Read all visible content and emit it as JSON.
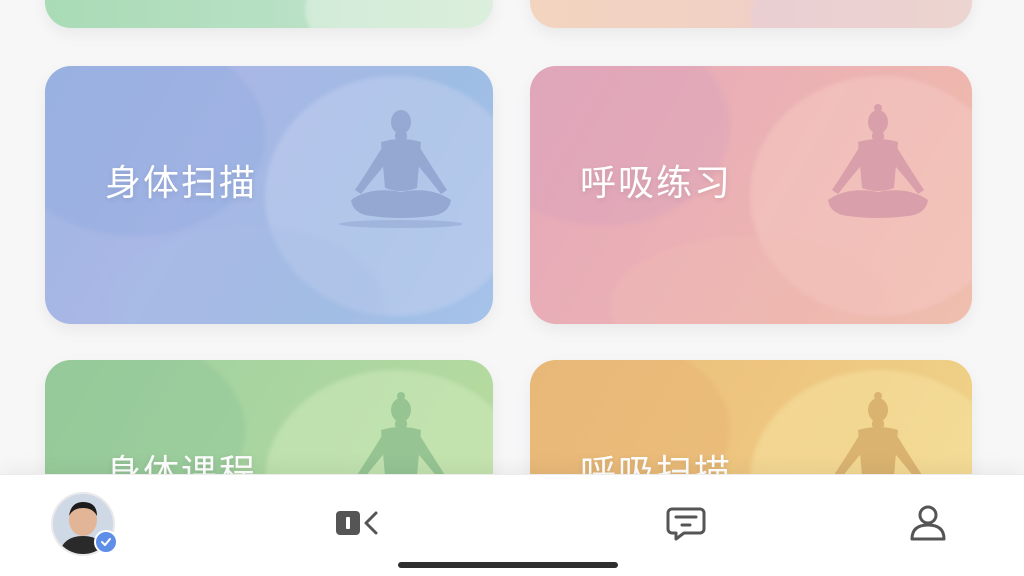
{
  "cards": {
    "body_scan": {
      "title": "身体扫描",
      "icon": "meditation-figure-icon"
    },
    "breathing_practice": {
      "title": "呼吸练习",
      "icon": "meditation-figure-icon"
    },
    "body_course": {
      "title": "身体课程",
      "icon": "meditation-figure-icon"
    },
    "breath_scan": {
      "title": "呼吸扫描",
      "icon": "meditation-figure-icon"
    }
  },
  "tab_bar": {
    "items": [
      {
        "name": "profile-avatar",
        "icon": "avatar-photo"
      },
      {
        "name": "video",
        "icon": "video-back-icon"
      },
      {
        "name": "messages",
        "icon": "chat-icon"
      },
      {
        "name": "account",
        "icon": "user-icon"
      }
    ]
  },
  "colors": {
    "body_scan": "#a6bbe5",
    "breathing_practice": "#e8b0b5",
    "body_course": "#a8d3a0",
    "breath_scan": "#edc47f",
    "tab_icon": "#555555",
    "badge": "#5f8ee8"
  }
}
